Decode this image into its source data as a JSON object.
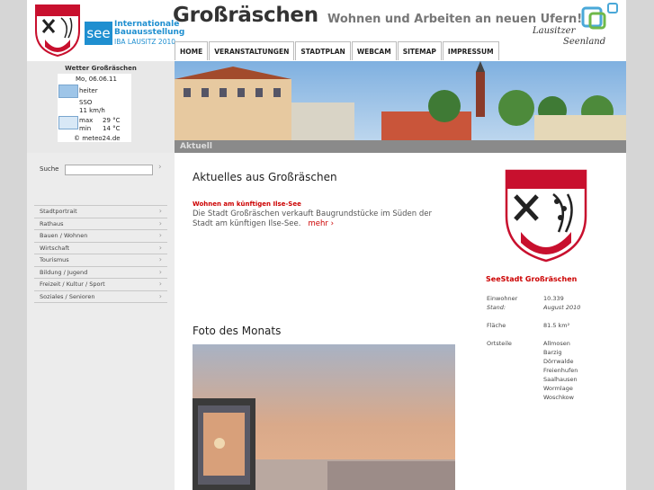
{
  "header": {
    "title": "Großräschen",
    "slogan": "Wohnen und Arbeiten an neuen Ufern!",
    "iba_logo": {
      "mark": "see",
      "line1": "Internationale",
      "line2": "Bauausstellung",
      "line3": "IBA LAUSITZ 2010",
      "color": "#1f8fd0"
    },
    "partner_logo": {
      "line1": "Lausitzer",
      "line2": "Seenland"
    }
  },
  "nav": {
    "items": [
      "HOME",
      "VERANSTALTUNGEN",
      "STADTPLAN",
      "WEBCAM",
      "SITEMAP",
      "IMPRESSUM"
    ]
  },
  "weather": {
    "title": "Wetter Großräschen",
    "date": "Mo, 06.06.11",
    "condition": "heiter",
    "wind_dir": "SSO",
    "wind_speed": "11 km/h",
    "max_label": "max",
    "max_value": "29 °C",
    "min_label": "min",
    "min_value": "14 °C",
    "credit": "© meteo24.de"
  },
  "banner": {
    "label": "Aktuell"
  },
  "sidebar": {
    "search_label": "Suche",
    "search_value": "",
    "search_button": "›",
    "items": [
      {
        "label": "Stadtportrait"
      },
      {
        "label": "Rathaus"
      },
      {
        "label": "Bauen / Wohnen"
      },
      {
        "label": "Wirtschaft"
      },
      {
        "label": "Tourismus"
      },
      {
        "label": "Bildung / Jugend"
      },
      {
        "label": "Freizeit / Kultur / Sport"
      },
      {
        "label": "Soziales / Senioren"
      }
    ]
  },
  "main": {
    "title": "Aktuelles aus Großräschen",
    "news": {
      "headline": "Wohnen am künftigen Ilse-See",
      "body": "Die Stadt Großräschen verkauft Baugrundstücke im Süden der Stadt am künftigen Ilse-See.",
      "more": "mehr ›"
    },
    "photo_title": "Foto des Monats"
  },
  "info": {
    "title": "SeeStadt Großräschen",
    "residents_label": "Einwohner",
    "residents_value": "10.339",
    "stand_label": "Stand:",
    "stand_value": "August 2010",
    "area_label": "Fläche",
    "area_value": "81.5 km²",
    "districts_label": "Ortsteile",
    "districts": [
      "Allmosen",
      "Barzig",
      "Dörrwalde",
      "Freienhufen",
      "Saalhausen",
      "Wormlage",
      "Woschkow"
    ]
  },
  "colors": {
    "accent": "#cc0000",
    "crest_red": "#c8102e"
  }
}
